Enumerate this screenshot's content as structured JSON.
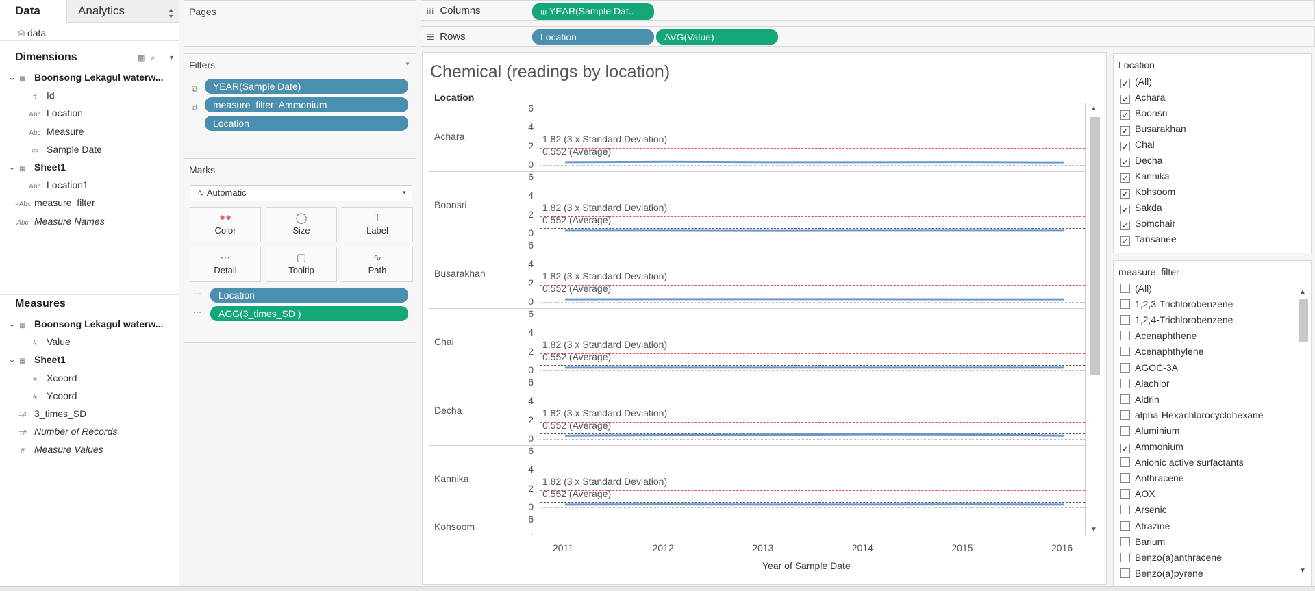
{
  "data_pane": {
    "tab_data": "Data",
    "tab_analytics": "Analytics",
    "source": "data",
    "dimensions_title": "Dimensions",
    "dimensions": [
      {
        "label": "Boonsong Lekagul waterw...",
        "icon": "table",
        "kind": "group"
      },
      {
        "label": "Id",
        "icon": "#",
        "kind": "field"
      },
      {
        "label": "Location",
        "icon": "Abc",
        "kind": "field"
      },
      {
        "label": "Measure",
        "icon": "Abc",
        "kind": "field"
      },
      {
        "label": "Sample Date",
        "icon": "calendar",
        "kind": "field"
      },
      {
        "label": "Sheet1",
        "icon": "table",
        "kind": "group"
      },
      {
        "label": "Location1",
        "icon": "Abc",
        "kind": "field"
      },
      {
        "label": "measure_filter",
        "icon": "=Abc",
        "kind": "top"
      },
      {
        "label": "Measure Names",
        "icon": "Abc",
        "kind": "top-italic"
      }
    ],
    "measures_title": "Measures",
    "measures": [
      {
        "label": "Boonsong Lekagul waterw...",
        "icon": "table",
        "kind": "group"
      },
      {
        "label": "Value",
        "icon": "#",
        "kind": "field"
      },
      {
        "label": "Sheet1",
        "icon": "table",
        "kind": "group"
      },
      {
        "label": "Xcoord",
        "icon": "#",
        "kind": "field"
      },
      {
        "label": "Ycoord",
        "icon": "#",
        "kind": "field"
      },
      {
        "label": "3_times_SD",
        "icon": "=#",
        "kind": "top"
      },
      {
        "label": "Number of Records",
        "icon": "=#",
        "kind": "top-italic"
      },
      {
        "label": "Measure Values",
        "icon": "#",
        "kind": "top-italic"
      }
    ]
  },
  "pages": {
    "title": "Pages"
  },
  "filters": {
    "title": "Filters",
    "items": [
      "YEAR(Sample Date)",
      "measure_filter: Ammonium",
      "Location"
    ]
  },
  "marks": {
    "title": "Marks",
    "type": "Automatic",
    "buttons": [
      "Color",
      "Size",
      "Label",
      "Detail",
      "Tooltip",
      "Path"
    ],
    "pills": [
      "Location",
      "AGG(3_times_SD )"
    ]
  },
  "shelves": {
    "columns_label": "Columns",
    "columns": [
      "YEAR(Sample Dat.."
    ],
    "rows_label": "Rows",
    "rows": [
      "Location",
      "AVG(Value)"
    ]
  },
  "chart_data": {
    "type": "line",
    "title": "Chemical (readings by location)",
    "row_header": "Location",
    "xlabel": "Year of Sample Date",
    "x": [
      2011,
      2012,
      2013,
      2014,
      2015,
      2016
    ],
    "ylim": [
      0,
      6
    ],
    "yticks": [
      6,
      4,
      2,
      0
    ],
    "reference_lines": {
      "sd_label": "1.82 (3 x Standard Deviation)",
      "sd_value": 1.82,
      "avg_label": "0.552 (Average)",
      "avg_value": 0.552,
      "sd_color": "#e05050",
      "avg_color": "#555555"
    },
    "series": [
      {
        "name": "Achara",
        "values": [
          0.3,
          0.35,
          0.3,
          0.3,
          0.32,
          0.28
        ]
      },
      {
        "name": "Boonsri",
        "values": [
          0.3,
          0.3,
          0.28,
          0.3,
          0.3,
          0.3
        ]
      },
      {
        "name": "Busarakhan",
        "values": [
          0.28,
          0.3,
          0.3,
          0.3,
          0.28,
          0.28
        ]
      },
      {
        "name": "Chai",
        "values": [
          0.3,
          0.3,
          0.3,
          0.3,
          0.3,
          0.3
        ]
      },
      {
        "name": "Decha",
        "values": [
          0.35,
          0.4,
          0.45,
          0.5,
          0.48,
          0.35
        ]
      },
      {
        "name": "Kannika",
        "values": [
          0.3,
          0.32,
          0.3,
          0.3,
          0.32,
          0.3
        ]
      },
      {
        "name": "Kohsoom",
        "values": []
      }
    ],
    "line_color": "#6c96c8"
  },
  "location_filter": {
    "title": "Location",
    "items": [
      {
        "label": "(All)",
        "checked": true
      },
      {
        "label": "Achara",
        "checked": true
      },
      {
        "label": "Boonsri",
        "checked": true
      },
      {
        "label": "Busarakhan",
        "checked": true
      },
      {
        "label": "Chai",
        "checked": true
      },
      {
        "label": "Decha",
        "checked": true
      },
      {
        "label": "Kannika",
        "checked": true
      },
      {
        "label": "Kohsoom",
        "checked": true
      },
      {
        "label": "Sakda",
        "checked": true
      },
      {
        "label": "Somchair",
        "checked": true
      },
      {
        "label": "Tansanee",
        "checked": true
      }
    ]
  },
  "measure_filter": {
    "title": "measure_filter",
    "items": [
      {
        "label": "(All)",
        "checked": false
      },
      {
        "label": "1,2,3-Trichlorobenzene",
        "checked": false
      },
      {
        "label": "1,2,4-Trichlorobenzene",
        "checked": false
      },
      {
        "label": "Acenaphthene",
        "checked": false
      },
      {
        "label": "Acenaphthylene",
        "checked": false
      },
      {
        "label": "AGOC-3A",
        "checked": false
      },
      {
        "label": "Alachlor",
        "checked": false
      },
      {
        "label": "Aldrin",
        "checked": false
      },
      {
        "label": "alpha-Hexachlorocyclohexane",
        "checked": false
      },
      {
        "label": "Aluminium",
        "checked": false
      },
      {
        "label": "Ammonium",
        "checked": true
      },
      {
        "label": "Anionic active surfactants",
        "checked": false
      },
      {
        "label": "Anthracene",
        "checked": false
      },
      {
        "label": "AOX",
        "checked": false
      },
      {
        "label": "Arsenic",
        "checked": false
      },
      {
        "label": "Atrazine",
        "checked": false
      },
      {
        "label": "Barium",
        "checked": false
      },
      {
        "label": "Benzo(a)anthracene",
        "checked": false
      },
      {
        "label": "Benzo(a)pyrene",
        "checked": false
      }
    ]
  }
}
